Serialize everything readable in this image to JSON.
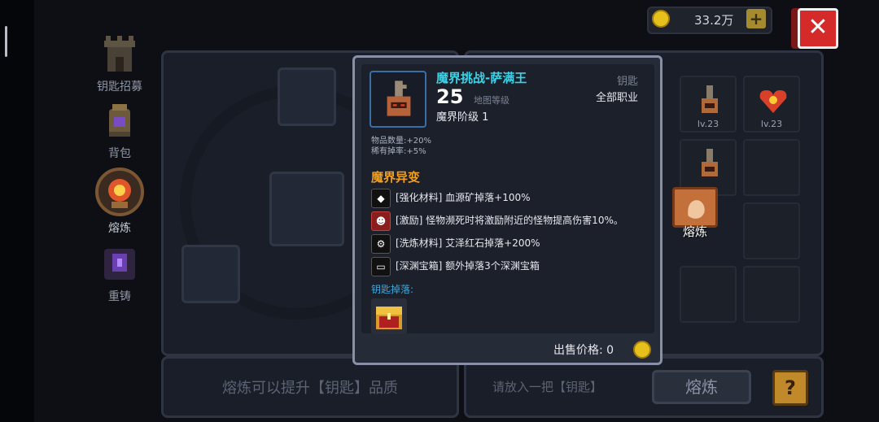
{
  "topbar": {
    "gold_amount": "33.2万",
    "plus_label": "+",
    "close_label": "✕"
  },
  "sidebar": {
    "items": [
      {
        "label": "钥匙招募",
        "icon": "tower-icon"
      },
      {
        "label": "背包",
        "icon": "backpack-icon"
      },
      {
        "label": "熔炼",
        "icon": "forge-icon"
      },
      {
        "label": "重铸",
        "icon": "anvil-icon"
      }
    ]
  },
  "left_panel": {
    "hint": "熔炼可以提升【钥匙】品质"
  },
  "right_panel": {
    "hint": "请放入一把【钥匙】",
    "smelt_button": "熔炼",
    "help_button": "?",
    "grid_items": [
      {
        "level": "lv.23",
        "icon": "key-icon"
      },
      {
        "level": "lv.23",
        "icon": "heart-icon"
      }
    ],
    "float_smelt_label": "熔炼"
  },
  "tooltip": {
    "title": "魔界挑战-萨满王",
    "level": "25",
    "level_label": "地图等级",
    "tier": "魔界阶级 1",
    "type": "钥匙",
    "job": "全部职业",
    "stats": [
      "物品数量:+20%",
      "稀有掉率:+5%"
    ],
    "section_title": "魔界异变",
    "mods": [
      {
        "text": "[强化材料] 血源矿掉落+100%",
        "icon": "diamond-icon"
      },
      {
        "text": "[激励] 怪物濒死时将激励附近的怪物提高伤害10%。",
        "icon": "demon-icon"
      },
      {
        "text": "[洗炼材料] 艾泽红石掉落+200%",
        "icon": "gear-icon"
      },
      {
        "text": "[深渊宝箱] 额外掉落3个深渊宝箱",
        "icon": "chest-icon"
      }
    ],
    "drops_label": "钥匙掉落:",
    "sell_label": "出售价格: 0"
  },
  "colors": {
    "title_cyan": "#39d3e8",
    "section_orange": "#f0a020",
    "gold": "#e6c11c",
    "close_red": "#d42a2a"
  }
}
